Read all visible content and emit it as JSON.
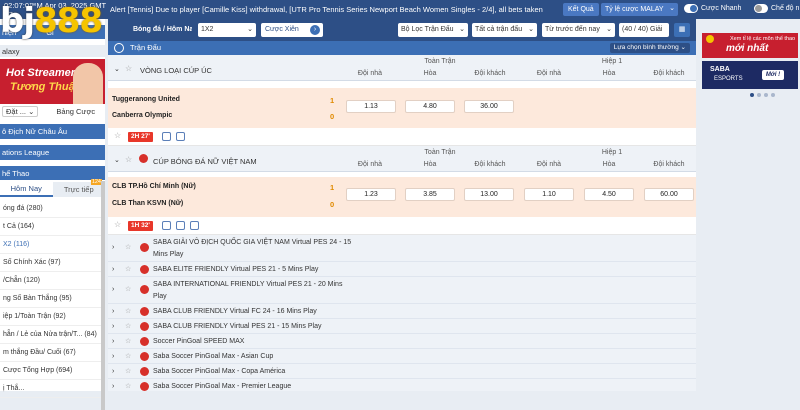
{
  "topbar": {
    "time": "02:07:0™M Apr 03, 2025 GMT - 7",
    "ticker": "Alert [Tennis] Due to player [Camille Kiss] withdrawal, [UTR Pro Tennis Series Newport Beach Women Singles - 2/4], all bets taken",
    "ket_qua": "Kết Quả",
    "odds_type": "Tỷ lệ cược MALAY",
    "odds_caret": "⌄",
    "cuoc_nhanh": "Cược Nhanh",
    "che_do": "Chế độ n"
  },
  "logo": {
    "left": "bj",
    "right": "888"
  },
  "sidebar": {
    "row1": "hiện",
    "row1b": "Gi",
    "row2": "alaxy",
    "banner_line1": "Hot Streamer",
    "banner_line2": "Tương Thuật",
    "bet_select": "Đặt ...",
    "bet_caret": "⌄",
    "bang_cuoc": "Bảng Cược",
    "sections": [
      {
        "label": "ô Địch Nữ Châu Âu"
      },
      {
        "label": "ations League"
      },
      {
        "label": "hể Thao"
      }
    ],
    "tab_today": "Hôm Nay",
    "tab_live": "Trực tiếp",
    "live_count": "124",
    "items": [
      "óng đá (280)",
      "t Cả (164)",
      "X2 (116)",
      "Số Chính Xác (97)",
      "/Chẵn (120)",
      "ng Số Bàn Thắng (95)",
      "iệp 1/Toàn Trận (92)",
      "hẵn / Lẻ của Nửa trận/T... (84)",
      "m thắng Đầu/ Cuối (67)",
      "Cược Tổng Hợp (694)",
      "ị Thắ..."
    ]
  },
  "filter": {
    "sport": "Bóng đá / Hôm Nay",
    "market": "1X2",
    "cuoc_xien": "Cược Xiên",
    "loc_tran": "Bộ Lọc Trận Đấu",
    "all_bets": "Tất cả trận đấu",
    "sort": "Từ trước đến nay",
    "count": "(40 / 40) Giải",
    "caret": "⌄",
    "grid_icon": "grid-icon",
    "arrow": "›"
  },
  "tran_dau": {
    "label": "Trận Đấu",
    "filter_btn": "Lựa chọn bình thường",
    "filter_caret": "⌄"
  },
  "groups": [
    {
      "league": "VÒNG LOẠI CÚP ÚC",
      "header_full": "Toàn Trận",
      "header_half": "Hiệp 1",
      "cols": [
        "Đội nhà",
        "Hòa",
        "Đội khách",
        "Đội nhà",
        "Hòa",
        "Đội khách"
      ],
      "home": "Tuggeranong United",
      "away": "Canberra Olympic",
      "home_score": "1",
      "away_score": "0",
      "odds": [
        "1.13",
        "4.80",
        "36.00"
      ],
      "time": "2H 27'"
    },
    {
      "league": "CÚP BÓNG ĐÁ NỮ VIỆT NAM",
      "header_full": "Toàn Trận",
      "header_half": "Hiệp 1",
      "cols": [
        "Đội nhà",
        "Hòa",
        "Đội khách",
        "Đội nhà",
        "Hòa",
        "Đội khách"
      ],
      "home": "CLB TP.Hồ Chí Minh (Nữ)",
      "away": "CLB Than KSVN (Nữ)",
      "home_score": "1",
      "away_score": "0",
      "odds": [
        "1.23",
        "3.85",
        "13.00",
        "1.10",
        "4.50",
        "60.00"
      ],
      "time": "1H 32'"
    }
  ],
  "list": [
    {
      "name": "SABA GIẢI VÔ ĐỊCH QUỐC GIA VIỆT NAM Virtual PES 24 - 15 Mins Play",
      "two": true
    },
    {
      "name": "SABA ELITE FRIENDLY Virtual PES 21 - 5 Mins Play",
      "two": false
    },
    {
      "name": "SABA INTERNATIONAL FRIENDLY Virtual PES 21 - 20 Mins Play",
      "two": true
    },
    {
      "name": "SABA CLUB FRIENDLY Virtual FC 24 - 16 Mins Play",
      "two": false
    },
    {
      "name": "SABA CLUB FRIENDLY Virtual PES 21 - 15 Mins Play",
      "two": false
    },
    {
      "name": "Soccer PinGoal SPEED MAX",
      "two": false
    },
    {
      "name": "Saba Soccer PinGoal Max - Asian Cup",
      "two": false
    },
    {
      "name": "Saba Soccer PinGoal Max - Copa América",
      "two": false
    },
    {
      "name": "Saba Soccer PinGoal Max - Premier League",
      "two": false
    }
  ],
  "right_panel": {
    "banner1_small": "Xem tỉ lệ các môn thể thao",
    "banner1_big": "mới nhất",
    "banner2_saba": "SABA",
    "banner2_esports": "ESPORTS",
    "banner2_moi": "Mới !"
  },
  "colors": {
    "topbar": "#2d4f86",
    "accent_blue": "#3c6fb5",
    "match_bg": "#fde9dc",
    "live_red": "#e8372a",
    "score_orange": "#e08a00"
  }
}
